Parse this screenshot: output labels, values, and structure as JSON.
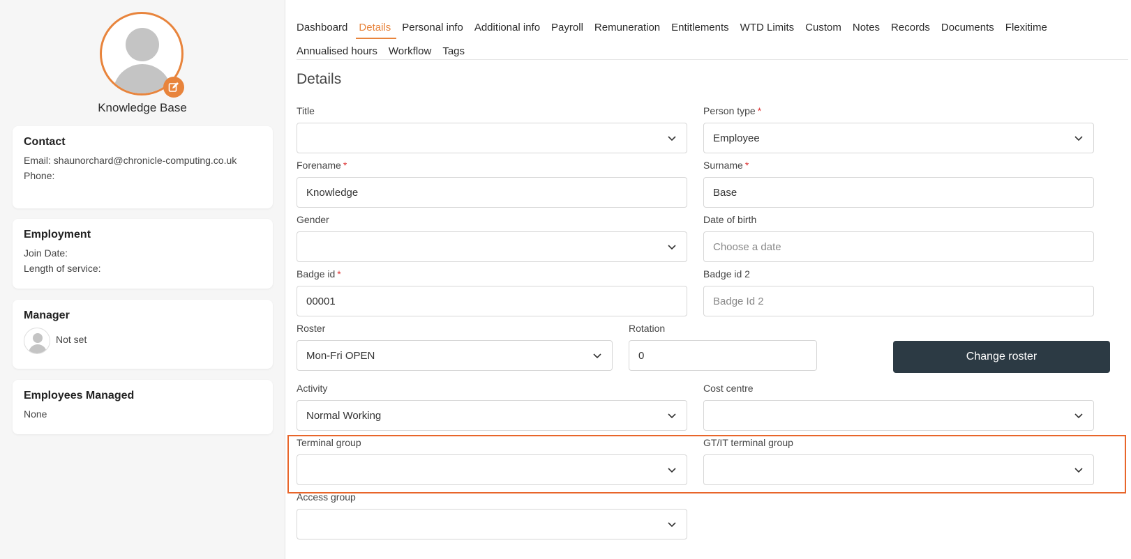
{
  "profile": {
    "name": "Knowledge Base"
  },
  "contact": {
    "heading": "Contact",
    "email": "Email: shaunorchard@chronicle-computing.co.uk",
    "phone": "Phone:"
  },
  "employment": {
    "heading": "Employment",
    "join_date": "Join Date:",
    "length_of_service": "Length of service:"
  },
  "manager": {
    "heading": "Manager",
    "value": "Not set"
  },
  "managed": {
    "heading": "Employees Managed",
    "value": "None"
  },
  "tabs": [
    "Dashboard",
    "Details",
    "Personal info",
    "Additional info",
    "Payroll",
    "Remuneration",
    "Entitlements",
    "WTD Limits",
    "Custom",
    "Notes",
    "Records",
    "Documents",
    "Flexitime",
    "Annualised hours",
    "Workflow",
    "Tags"
  ],
  "active_tab": "Details",
  "section_title": "Details",
  "fields": {
    "title": {
      "label": "Title",
      "value": ""
    },
    "person_type": {
      "label": "Person type",
      "value": "Employee"
    },
    "forename": {
      "label": "Forename",
      "value": "Knowledge"
    },
    "surname": {
      "label": "Surname",
      "value": "Base"
    },
    "gender": {
      "label": "Gender",
      "value": ""
    },
    "dob": {
      "label": "Date of birth",
      "placeholder": "Choose a date"
    },
    "badge_id": {
      "label": "Badge id",
      "value": "00001"
    },
    "badge_id2": {
      "label": "Badge id 2",
      "placeholder": "Badge Id 2"
    },
    "roster": {
      "label": "Roster",
      "value": "Mon-Fri OPEN"
    },
    "rotation": {
      "label": "Rotation",
      "value": "0"
    },
    "activity": {
      "label": "Activity",
      "value": "Normal Working"
    },
    "cost_centre": {
      "label": "Cost centre",
      "value": ""
    },
    "terminal_group": {
      "label": "Terminal group",
      "value": ""
    },
    "gt_terminal_group": {
      "label": "GT/IT terminal group",
      "value": ""
    },
    "access_group": {
      "label": "Access group",
      "value": ""
    }
  },
  "required_marker": "*",
  "change_roster_label": "Change roster",
  "colors": {
    "accent": "#e8843c",
    "button": "#2c3a44",
    "highlight": "#e8652a",
    "required": "#d33333"
  }
}
